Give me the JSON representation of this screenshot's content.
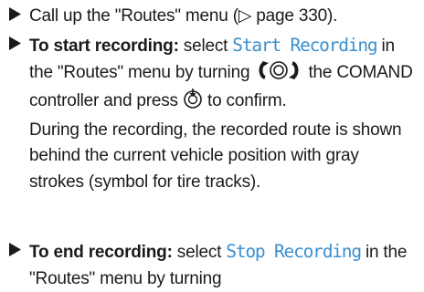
{
  "steps": [
    {
      "text": "Call up the \"Routes\" menu (▷ page 330)."
    },
    {
      "lead": "To start recording:",
      "pre": " select ",
      "menu_item": "Start Recording",
      "post1": " in the \"Routes\" menu by turning ",
      "post2": " the COMAND controller and press ",
      "post3": " to confirm.",
      "result": "During the recording, the recorded route is shown behind the current vehicle position with gray strokes (symbol for tire tracks)."
    },
    {
      "lead": "To end recording:",
      "pre": " select ",
      "menu_item": "Stop Recording",
      "post1": " in the \"Routes\" menu by turning"
    }
  ],
  "icons": {
    "bullet": "triangle-bullet-icon",
    "turn": "controller-turn-icon",
    "press": "controller-press-icon"
  },
  "colors": {
    "menu_item": "#3a8fd0",
    "text": "#1a1a1a"
  }
}
